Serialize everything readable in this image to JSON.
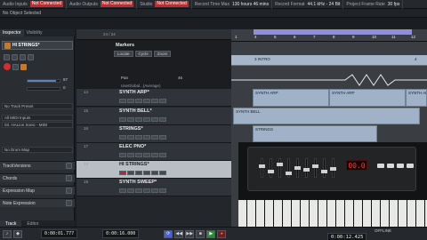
{
  "status_bar": {
    "audio_inputs_label": "Audio Inputs",
    "audio_inputs_value": "Not Connected",
    "audio_outputs_label": "Audio Outputs",
    "audio_outputs_value": "Not Connected",
    "studio_label": "Studio",
    "studio_value": "Not Connected",
    "record_time_label": "Record Time Max",
    "record_time_value": "130 hours 46 mins",
    "record_format_label": "Record Format",
    "record_format_value": "44.1 kHz - 24 Bit",
    "frame_rate_label": "Project Frame Rate",
    "frame_rate_value": "30 fps"
  },
  "status_line": "No Object Selected",
  "inspector": {
    "tabs": [
      "Inspector",
      "Visibility"
    ],
    "track_name": "HI STRINGS*",
    "input_routing": "All MIDI Inputs",
    "output_routing": "03. HALion Sonic - MIDI",
    "no_track_preset": "No Track Preset",
    "no_drum_map": "No Drum Map",
    "volume_value": "87",
    "pan_value": "0",
    "sections": [
      "TrackVersions",
      "Chords",
      "Expression Map",
      "Note Expression"
    ],
    "bottom_tabs": [
      "Track",
      "Editor"
    ]
  },
  "project": {
    "page_counter": "24 / 24",
    "marker_title": "Markers",
    "marker_buttons": [
      "Locate",
      "Cycle",
      "Zoom"
    ],
    "marker_lane_labels": [
      "3 INTRO",
      "4"
    ],
    "pan_label": "Pan",
    "pan_value": "46",
    "use_global_label": "UseGlobal...(Average)",
    "ruler_marks": [
      "1",
      "4",
      "5",
      "6",
      "7",
      "8",
      "9",
      "10",
      "11",
      "12"
    ],
    "tracks": [
      {
        "num": "14",
        "name": "SYNTH ARP*"
      },
      {
        "num": "15",
        "name": "SYNTH BELL*"
      },
      {
        "num": "16",
        "name": "STRINGS*"
      },
      {
        "num": "17",
        "name": "ELEC PNO*"
      },
      {
        "num": "18",
        "name": "HI STRINGS*"
      },
      {
        "num": "19",
        "name": "SYNTH SWEEP*"
      }
    ],
    "parts": [
      {
        "name": "SYNTH ARP",
        "track": 0
      },
      {
        "name": "SYNTH ARP",
        "track": 0
      },
      {
        "name": "SYNTH ARP",
        "track": 0
      },
      {
        "name": "SYNTH BELL",
        "track": 1
      },
      {
        "name": "STRINGS",
        "track": 2
      }
    ]
  },
  "overlay": {
    "led_display": "00.0"
  },
  "transport": {
    "left_locator": "0:00:01.777",
    "right_locator": "0:00:16.000",
    "position": "0:00:12.425",
    "sync_label": "OFFLINE",
    "buttons": [
      "cycle",
      "rewind",
      "forward",
      "stop",
      "play",
      "record"
    ]
  },
  "colors": {
    "accent_cycle": "#8f8ed9",
    "record_red": "#d12f2f",
    "part_blue": "#9fb2c7",
    "status_red": "#c52a2a"
  }
}
